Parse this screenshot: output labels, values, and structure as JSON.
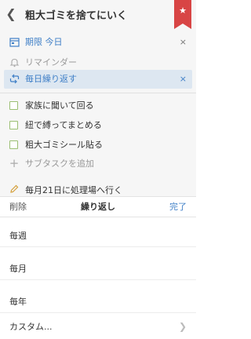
{
  "header": {
    "back_icon": "chevron-left-icon",
    "title": "粗大ゴミを捨てにいく",
    "bookmark_icon": "star-icon",
    "bookmark_color": "#d84545"
  },
  "details": {
    "due": {
      "icon": "calendar-icon",
      "label": "期限 今日",
      "clear": "×"
    },
    "reminder": {
      "icon": "bell-icon",
      "label": "リマインダー"
    },
    "repeat": {
      "icon": "repeat-icon",
      "label": "毎日繰り返す",
      "clear": "×"
    }
  },
  "subtasks": [
    {
      "label": "家族に聞いて回る"
    },
    {
      "label": "紐で縛ってまとめる"
    },
    {
      "label": "粗大ゴミシール貼る"
    }
  ],
  "add_subtask": {
    "icon": "plus-icon",
    "label": "サブタスクを追加"
  },
  "note": {
    "icon": "pencil-icon",
    "text": "毎月21日に処理場へ行く"
  },
  "sheet": {
    "delete_label": "削除",
    "title": "繰り返し",
    "done_label": "完了",
    "options": [
      {
        "label": "毎週"
      },
      {
        "label": "毎月"
      },
      {
        "label": "毎年"
      },
      {
        "label": "カスタム..."
      }
    ]
  },
  "colors": {
    "accent": "#3f7fc7",
    "checkbox": "#9bbf73",
    "bookmark": "#d84545"
  }
}
